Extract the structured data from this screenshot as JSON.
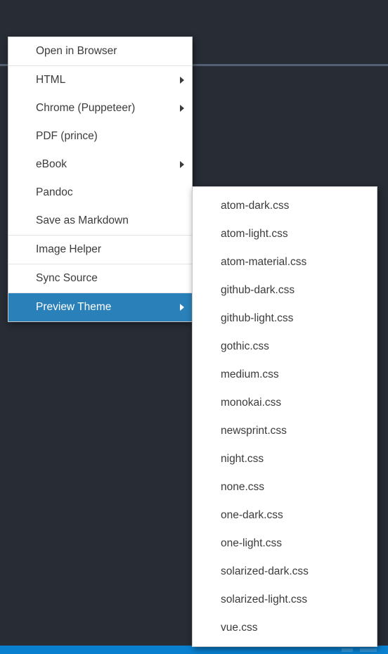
{
  "window": {
    "background_color": "#272c35",
    "rule_color": "#555f73"
  },
  "status_bar": {
    "background_color": "#0980d0"
  },
  "context_menu": {
    "name": "markdown-preview-context-menu",
    "highlight_color": "#2a80b9",
    "groups": [
      {
        "items": [
          {
            "label": "Open in Browser",
            "has_submenu": false,
            "selected": false
          }
        ]
      },
      {
        "items": [
          {
            "label": "HTML",
            "has_submenu": true,
            "selected": false
          },
          {
            "label": "Chrome (Puppeteer)",
            "has_submenu": true,
            "selected": false
          },
          {
            "label": "PDF (prince)",
            "has_submenu": false,
            "selected": false
          },
          {
            "label": "eBook",
            "has_submenu": true,
            "selected": false
          },
          {
            "label": "Pandoc",
            "has_submenu": false,
            "selected": false
          },
          {
            "label": "Save as Markdown",
            "has_submenu": false,
            "selected": false
          }
        ]
      },
      {
        "items": [
          {
            "label": "Image Helper",
            "has_submenu": false,
            "selected": false
          }
        ]
      },
      {
        "items": [
          {
            "label": "Sync Source",
            "has_submenu": false,
            "selected": false
          }
        ]
      },
      {
        "items": [
          {
            "label": "Preview Theme",
            "has_submenu": true,
            "selected": true
          }
        ]
      }
    ]
  },
  "theme_submenu": {
    "name": "preview-theme-submenu",
    "items": [
      {
        "label": "atom-dark.css"
      },
      {
        "label": "atom-light.css"
      },
      {
        "label": "atom-material.css"
      },
      {
        "label": "github-dark.css"
      },
      {
        "label": "github-light.css"
      },
      {
        "label": "gothic.css"
      },
      {
        "label": "medium.css"
      },
      {
        "label": "monokai.css"
      },
      {
        "label": "newsprint.css"
      },
      {
        "label": "night.css"
      },
      {
        "label": "none.css"
      },
      {
        "label": "one-dark.css"
      },
      {
        "label": "one-light.css"
      },
      {
        "label": "solarized-dark.css"
      },
      {
        "label": "solarized-light.css"
      },
      {
        "label": "vue.css"
      }
    ]
  }
}
